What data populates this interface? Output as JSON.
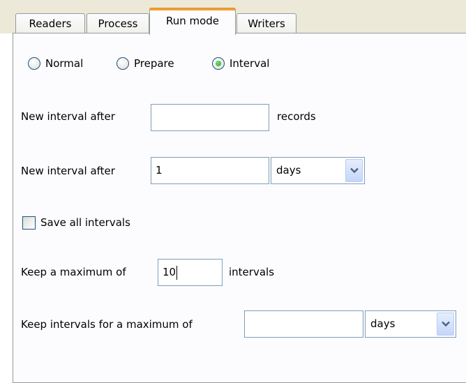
{
  "tabs": [
    {
      "label": "Readers"
    },
    {
      "label": "Process"
    },
    {
      "label": "Run mode"
    },
    {
      "label": "Writers"
    }
  ],
  "active_tab": "Run mode",
  "run_mode": {
    "options": [
      {
        "label": "Normal",
        "checked": false
      },
      {
        "label": "Prepare",
        "checked": false
      },
      {
        "label": "Interval",
        "checked": true
      }
    ],
    "records_row": {
      "label": "New interval after",
      "value": "",
      "suffix": "records"
    },
    "time_row": {
      "label": "New interval after",
      "value": "1",
      "unit": "days"
    },
    "save_all": {
      "label": "Save all intervals",
      "checked": false
    },
    "max_intervals": {
      "label": "Keep a maximum of",
      "value": "10",
      "suffix": "intervals"
    },
    "keep_for": {
      "label": "Keep intervals for a maximum of",
      "value": "",
      "unit": "days"
    }
  },
  "colors": {
    "window_bg": "#ece9d8",
    "panel_bg": "#fcfcfe",
    "active_tab_accent": "#f0a030",
    "field_border": "#7f9db9",
    "radio_dot": "#21a121"
  },
  "icons": {
    "dropdown": "chevron-down-icon"
  }
}
